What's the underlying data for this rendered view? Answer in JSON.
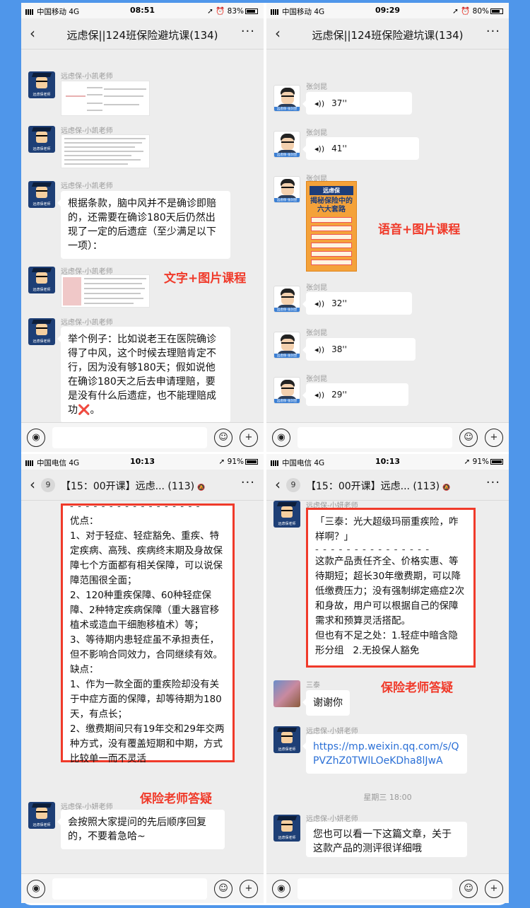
{
  "phone1": {
    "status": {
      "carrier": "中国移动",
      "network": "4G",
      "time": "08:51",
      "battery": "83%"
    },
    "nav": {
      "title": "远虑保||124班保险避坑课(134)"
    },
    "sender_teacher": "远虑保-小凯老师",
    "avatar_label": "远虑保老师",
    "msg_clause": "根据条款，脑中风并不是确诊即赔的，还需要在确诊180天后仍然出现了一定的后遗症（至少满足以下一项）：",
    "msg_example": "举个例子：比如说老王在医院确诊得了中风，这个时候去理赔肯定不行，因为没有够180天；假如说他在确诊180天之后去申请理赔，要是没有什么后遗症，也不能理赔成功",
    "msg_example_emoji": "❌",
    "overlay": "文字+图片课程"
  },
  "phone2": {
    "status": {
      "carrier": "中国移动",
      "network": "4G",
      "time": "09:29",
      "battery": "80%"
    },
    "nav": {
      "title": "远虑保||124班保险避坑课(134)"
    },
    "sender": "张剑昆",
    "avatar_label": "远虑保·张剑昆",
    "voices": [
      "37''",
      "41''",
      "32''",
      "38''",
      "29''"
    ],
    "poster": {
      "title": "远虑保",
      "sub": "揭秘保险中的六大套路"
    },
    "overlay": "语音+图片课程"
  },
  "phone3": {
    "status": {
      "carrier": "中国电信",
      "network": "4G",
      "time": "10:13",
      "battery": "91%"
    },
    "nav": {
      "badge": "9",
      "title": "【15：00开课】远虑... (113)"
    },
    "dashes": "- - - - - - - - - - - - - - - - -",
    "box_text": "优点：\n1、对于轻症、轻症豁免、重疾、特定疾病、高残、疾病终末期及身故保障七个方面都有相关保障，可以说保障范围很全面；\n2、120种重疾保障、60种轻症保障、2种特定疾病保障（重大器官移植术或造血干细胞移植术）等；\n3、等待期内患轻症虽不承担责任，但不影响合同效力，合同继续有效。\n缺点：\n1、作为一款全面的重疾险却没有关于中症方面的保障，却等待期为180天，有点长；\n2、缴费期间只有19年交和29年交两种方式，没有覆盖短期和中期，方式比较单一而不灵活",
    "overlay": "保险老师答疑",
    "sender_teacher": "远虑保-小妍老师",
    "msg_order": "会按照大家提问的先后顺序回复的，不要着急哈~"
  },
  "phone4": {
    "status": {
      "carrier": "中国电信",
      "network": "4G",
      "time": "10:13",
      "battery": "91%"
    },
    "nav": {
      "badge": "9",
      "title": "【15：00开课】远虑... (113)"
    },
    "sender_teacher": "远虑保-小妍老师",
    "box_quote": "「三泰：光大超级玛丽重疾险，咋样啊？」",
    "dashes": "- - - - - - - - - - - - - - -",
    "box_text": "这款产品责任齐全、价格实惠、等待期短；超长30年缴费期，可以降低缴费压力；没有强制绑定癌症2次和身故，用户可以根据自己的保障需求和预算灵活搭配。\n但也有不足之处：1.轻症中暗含隐形分组   2.无投保人豁免",
    "overlay": "保险老师答疑",
    "sender_santai": "三泰",
    "msg_thanks": "谢谢你",
    "link": "https://mp.weixin.qq.com/s/QPVZhZ0TWlLOeKDha8lJwA",
    "timestamp": "星期三 18:00",
    "msg_article": "您也可以看一下这篇文章，关于这款产品的测评很详细哦"
  },
  "colors": {
    "accent_red": "#f03a2a",
    "frame_blue": "#4f96ea",
    "link_blue": "#2a6fd6"
  }
}
